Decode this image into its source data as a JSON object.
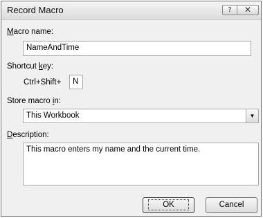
{
  "window": {
    "title": "Record Macro",
    "help_glyph": "?",
    "close_glyph": "✕"
  },
  "macro_name": {
    "label_pre": "",
    "label_key": "M",
    "label_post": "acro name:",
    "value": "NameAndTime"
  },
  "shortcut": {
    "label_pre": "Shortcut ",
    "label_key": "k",
    "label_post": "ey:",
    "prefix": "Ctrl+Shift+",
    "key_value": "N"
  },
  "store": {
    "label_pre": "Store macro ",
    "label_key": "i",
    "label_post": "n:",
    "selected": "This Workbook",
    "arrow_glyph": "▼"
  },
  "description": {
    "label_pre": "",
    "label_key": "D",
    "label_post": "escription:",
    "value": "This macro enters my name and the current time."
  },
  "buttons": {
    "ok": "OK",
    "cancel": "Cancel"
  }
}
